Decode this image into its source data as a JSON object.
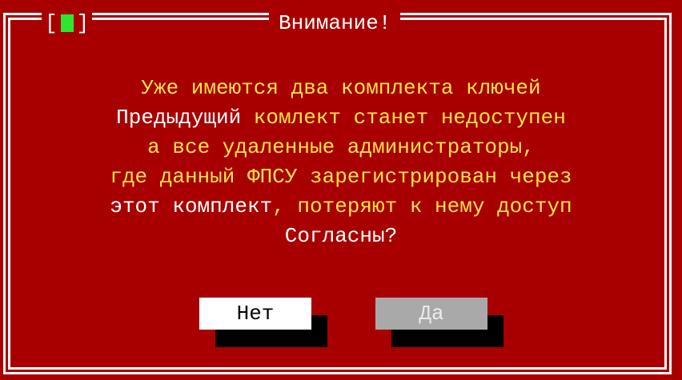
{
  "dialog": {
    "title": "Внимание!",
    "close_left": "[",
    "close_right": "]"
  },
  "message": {
    "lines": [
      [
        {
          "text": "Уже имеются два комплекта ключей",
          "color": "yellow"
        }
      ],
      [
        {
          "text": "Предыдущий ",
          "color": "white"
        },
        {
          "text": "комлект станет недоступен",
          "color": "yellow"
        }
      ],
      [
        {
          "text": "а все удаленные администраторы,",
          "color": "yellow"
        }
      ],
      [
        {
          "text": "где данный ФПСУ зарегистрирован через",
          "color": "yellow"
        }
      ],
      [
        {
          "text": "этот комплект",
          "color": "white"
        },
        {
          "text": ", потеряют к нему доступ",
          "color": "yellow"
        }
      ],
      [
        {
          "text": "Согласны?",
          "color": "white"
        }
      ]
    ]
  },
  "buttons": {
    "no_label": "Нет",
    "yes_label": "Да"
  },
  "colors": {
    "background": "#a80000",
    "frame": "#ffffff",
    "text_yellow": "#ffe24a",
    "text_white": "#ffffff",
    "close_indicator": "#2ee62e",
    "button_focused_bg": "#ffffff",
    "button_disabled_bg": "#a9a9a9",
    "button_shadow": "#000000"
  }
}
